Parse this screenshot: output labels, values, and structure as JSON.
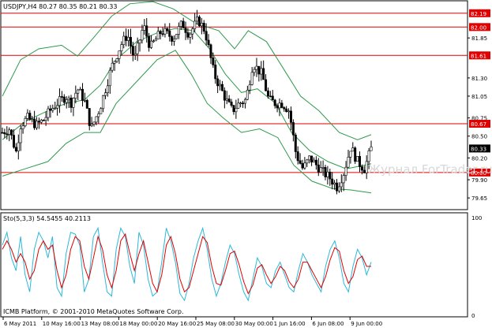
{
  "symbol_header": "USDJPY,H4  80.27 80.35 80.21 80.33",
  "watermark": "Журнал ForTrader.ru",
  "sto_header": "Sto(5,3,3) 54.5455 40.2113",
  "copyright": "ICMB Platform, © 2001-2010 MetaQuotes Software Corp.",
  "colors": {
    "bull": "#ffffff",
    "bear": "#000000",
    "bollinger": "#2e9a4a",
    "hline": "#e00000",
    "sto_main": "#2bb8d8",
    "sto_signal": "#e00000",
    "current_price_box": "#000000"
  },
  "chart_data": [
    {
      "type": "candlestick",
      "title": "USDJPY,H4",
      "ylim": [
        79.5,
        82.35
      ],
      "price_ticks": [
        "82.19",
        "82.00",
        "81.85",
        "81.61",
        "81.30",
        "81.05",
        "80.75",
        "80.67",
        "80.50",
        "80.33",
        "80.20",
        "80.00",
        "79.90",
        "79.65"
      ],
      "price_tick_values": [
        82.19,
        82.0,
        81.85,
        81.61,
        81.3,
        81.05,
        80.75,
        80.67,
        80.5,
        80.33,
        80.2,
        80.0,
        79.9,
        79.65
      ],
      "highlighted_ticks": [
        {
          "label": "82.19",
          "kind": "level"
        },
        {
          "label": "82.00",
          "kind": "level"
        },
        {
          "label": "81.61",
          "kind": "level"
        },
        {
          "label": "80.67",
          "kind": "level"
        },
        {
          "label": "80.33",
          "kind": "current"
        },
        {
          "label": "80.00",
          "kind": "level"
        }
      ],
      "horizontal_levels": [
        82.19,
        82.0,
        81.61,
        80.67,
        80.0
      ],
      "x_labels": [
        "6 May 2011",
        "10 May 16:00",
        "13 May 08:00",
        "18 May 00:00",
        "20 May 16:00",
        "25 May 08:00",
        "30 May 00:00",
        "1 Jun 16:00",
        "6 Jun 08:00",
        "9 Jun 00:00"
      ],
      "close_path": [
        [
          0,
          80.55
        ],
        [
          6,
          80.6
        ],
        [
          12,
          80.28
        ],
        [
          16,
          80.65
        ],
        [
          22,
          80.75
        ],
        [
          30,
          80.65
        ],
        [
          36,
          80.72
        ],
        [
          42,
          80.85
        ],
        [
          48,
          80.95
        ],
        [
          56,
          81.05
        ],
        [
          60,
          80.95
        ],
        [
          66,
          81.15
        ],
        [
          72,
          81.0
        ],
        [
          78,
          80.6
        ],
        [
          86,
          80.9
        ],
        [
          96,
          81.45
        ],
        [
          104,
          81.75
        ],
        [
          110,
          81.9
        ],
        [
          116,
          81.55
        ],
        [
          124,
          82.02
        ],
        [
          130,
          81.72
        ],
        [
          140,
          81.95
        ],
        [
          150,
          81.85
        ],
        [
          158,
          82.05
        ],
        [
          164,
          81.9
        ],
        [
          172,
          82.1
        ],
        [
          178,
          81.95
        ],
        [
          186,
          81.35
        ],
        [
          192,
          81.15
        ],
        [
          198,
          80.95
        ],
        [
          202,
          80.85
        ],
        [
          208,
          80.95
        ],
        [
          214,
          81.0
        ],
        [
          220,
          81.5
        ],
        [
          228,
          81.35
        ],
        [
          234,
          81.0
        ],
        [
          240,
          80.95
        ],
        [
          246,
          80.95
        ],
        [
          252,
          80.85
        ],
        [
          258,
          80.25
        ],
        [
          264,
          80.05
        ],
        [
          270,
          80.2
        ],
        [
          276,
          80.1
        ],
        [
          282,
          80.0
        ],
        [
          288,
          79.92
        ],
        [
          294,
          79.8
        ],
        [
          300,
          80.0
        ],
        [
          306,
          80.35
        ],
        [
          312,
          80.15
        ],
        [
          318,
          80.05
        ],
        [
          324,
          80.33
        ]
      ],
      "bollinger_upper": [
        [
          0,
          81.05
        ],
        [
          16,
          81.55
        ],
        [
          32,
          81.7
        ],
        [
          52,
          81.75
        ],
        [
          66,
          81.6
        ],
        [
          80,
          81.85
        ],
        [
          96,
          82.15
        ],
        [
          112,
          82.32
        ],
        [
          132,
          82.35
        ],
        [
          150,
          82.25
        ],
        [
          170,
          82.05
        ],
        [
          190,
          81.95
        ],
        [
          204,
          81.7
        ],
        [
          216,
          81.95
        ],
        [
          232,
          81.8
        ],
        [
          248,
          81.4
        ],
        [
          262,
          81.05
        ],
        [
          278,
          80.85
        ],
        [
          296,
          80.55
        ],
        [
          312,
          80.45
        ],
        [
          324,
          80.52
        ]
      ],
      "bollinger_middle": [
        [
          0,
          80.45
        ],
        [
          20,
          80.7
        ],
        [
          40,
          80.85
        ],
        [
          56,
          80.95
        ],
        [
          72,
          81.0
        ],
        [
          86,
          81.2
        ],
        [
          100,
          81.55
        ],
        [
          118,
          81.8
        ],
        [
          136,
          81.92
        ],
        [
          152,
          81.98
        ],
        [
          168,
          81.95
        ],
        [
          182,
          81.7
        ],
        [
          196,
          81.35
        ],
        [
          210,
          81.1
        ],
        [
          224,
          81.15
        ],
        [
          240,
          80.95
        ],
        [
          254,
          80.55
        ],
        [
          270,
          80.3
        ],
        [
          286,
          80.15
        ],
        [
          302,
          80.05
        ],
        [
          318,
          80.1
        ],
        [
          324,
          80.12
        ]
      ],
      "bollinger_lower": [
        [
          0,
          79.95
        ],
        [
          20,
          80.05
        ],
        [
          40,
          80.15
        ],
        [
          56,
          80.4
        ],
        [
          72,
          80.55
        ],
        [
          86,
          80.55
        ],
        [
          100,
          80.95
        ],
        [
          118,
          81.25
        ],
        [
          136,
          81.55
        ],
        [
          152,
          81.68
        ],
        [
          166,
          81.35
        ],
        [
          180,
          80.95
        ],
        [
          194,
          80.75
        ],
        [
          210,
          80.55
        ],
        [
          226,
          80.6
        ],
        [
          242,
          80.48
        ],
        [
          256,
          80.1
        ],
        [
          272,
          79.88
        ],
        [
          290,
          79.78
        ],
        [
          306,
          79.76
        ],
        [
          324,
          79.72
        ]
      ]
    },
    {
      "type": "line",
      "title": "Sto(5,3,3)",
      "ylim": [
        0,
        100
      ],
      "y_ticks": [
        "100",
        "0"
      ],
      "y_tick_values": [
        100,
        0
      ],
      "series": [
        {
          "values": [
            75,
            90,
            60,
            45,
            85,
            40,
            20,
            70,
            90,
            80,
            60,
            85,
            25,
            15,
            65,
            90,
            88,
            75,
            20,
            35,
            85,
            95,
            55,
            20,
            15,
            70,
            95,
            85,
            50,
            30,
            90,
            75,
            35,
            15,
            20,
            55,
            95,
            80,
            55,
            18,
            10,
            30,
            60,
            80,
            95,
            70,
            35,
            15,
            30,
            55,
            75,
            65,
            40,
            20,
            10,
            35,
            60,
            50,
            30,
            25,
            45,
            55,
            40,
            25,
            20,
            45,
            65,
            55,
            40,
            30,
            20,
            50,
            70,
            80,
            60,
            30,
            20,
            50,
            70,
            60,
            40,
            55
          ]
        },
        {
          "values": [
            70,
            80,
            70,
            55,
            65,
            55,
            35,
            45,
            70,
            80,
            70,
            75,
            45,
            25,
            40,
            70,
            85,
            80,
            50,
            35,
            60,
            85,
            70,
            40,
            25,
            45,
            80,
            88,
            65,
            45,
            65,
            80,
            55,
            30,
            20,
            40,
            75,
            85,
            65,
            35,
            20,
            25,
            45,
            65,
            85,
            78,
            50,
            30,
            28,
            45,
            65,
            68,
            52,
            32,
            18,
            28,
            48,
            52,
            40,
            30,
            38,
            50,
            45,
            32,
            25,
            35,
            55,
            55,
            45,
            35,
            25,
            38,
            58,
            72,
            68,
            45,
            30,
            38,
            58,
            62,
            50,
            50
          ]
        }
      ]
    }
  ]
}
